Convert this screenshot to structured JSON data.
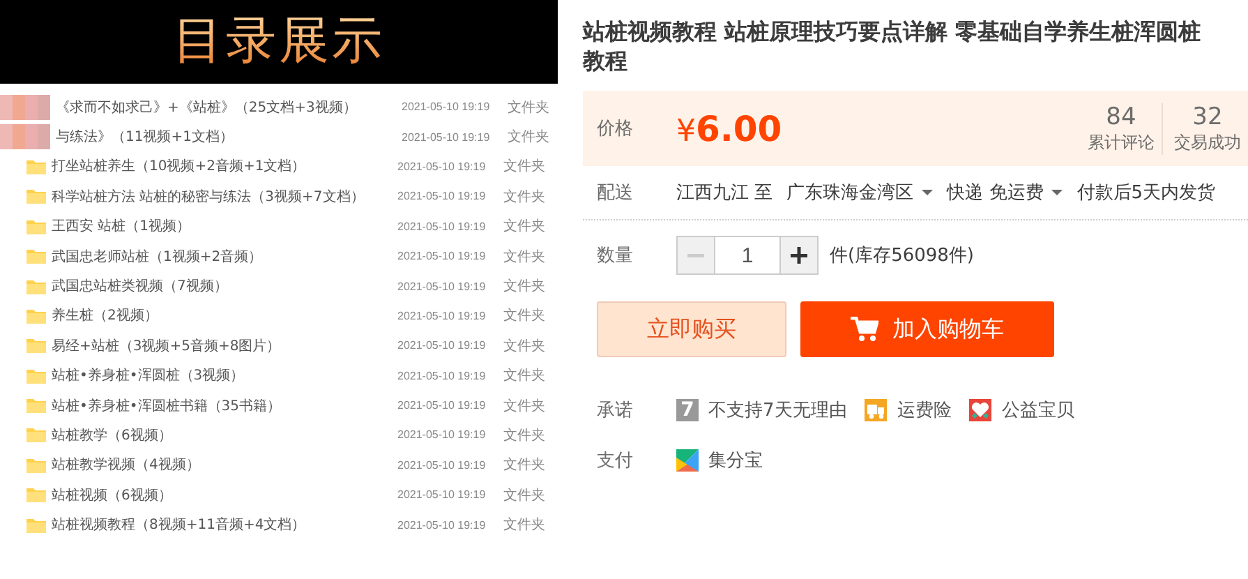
{
  "banner": {
    "title": "目录展示"
  },
  "files": [
    {
      "name": "《求而不如求己》+《站桩》（25文档+3视频）",
      "date": "2021-05-10 19:19",
      "type": "文件夹",
      "obscured": true
    },
    {
      "name": "与练法》（11视频+1文档）",
      "date": "2021-05-10 19:19",
      "type": "文件夹",
      "obscured": true
    },
    {
      "name": "打坐站桩养生（10视频+2音频+1文档）",
      "date": "2021-05-10 19:19",
      "type": "文件夹",
      "obscured": false
    },
    {
      "name": "科学站桩方法 站桩的秘密与练法（3视频+7文档）",
      "date": "2021-05-10 19:19",
      "type": "文件夹",
      "obscured": false
    },
    {
      "name": "王西安 站桩（1视频）",
      "date": "2021-05-10 19:19",
      "type": "文件夹",
      "obscured": false
    },
    {
      "name": "武国忠老师站桩（1视频+2音频）",
      "date": "2021-05-10 19:19",
      "type": "文件夹",
      "obscured": false
    },
    {
      "name": "武国忠站桩类视频（7视频）",
      "date": "2021-05-10 19:19",
      "type": "文件夹",
      "obscured": false
    },
    {
      "name": "养生桩（2视频）",
      "date": "2021-05-10 19:19",
      "type": "文件夹",
      "obscured": false
    },
    {
      "name": "易经+站桩（3视频+5音频+8图片）",
      "date": "2021-05-10 19:19",
      "type": "文件夹",
      "obscured": false
    },
    {
      "name": "站桩•养身桩•浑圆桩（3视频）",
      "date": "2021-05-10 19:19",
      "type": "文件夹",
      "obscured": false
    },
    {
      "name": "站桩•养身桩•浑圆桩书籍（35书籍）",
      "date": "2021-05-10 19:19",
      "type": "文件夹",
      "obscured": false
    },
    {
      "name": "站桩教学（6视频）",
      "date": "2021-05-10 19:19",
      "type": "文件夹",
      "obscured": false
    },
    {
      "name": "站桩教学视频（4视频）",
      "date": "2021-05-10 19:19",
      "type": "文件夹",
      "obscured": false
    },
    {
      "name": "站桩视频（6视频）",
      "date": "2021-05-10 19:19",
      "type": "文件夹",
      "obscured": false
    },
    {
      "name": "站桩视频教程（8视频+11音频+4文档）",
      "date": "2021-05-10 19:19",
      "type": "文件夹",
      "obscured": false
    }
  ],
  "product": {
    "title": "站桩视频教程 站桩原理技巧要点详解 零基础自学养生桩浑圆桩教程",
    "price": {
      "label": "价格",
      "currency": "¥",
      "amount": "6.00"
    },
    "stats": [
      {
        "value": "84",
        "label": "累计评论"
      },
      {
        "value": "32",
        "label": "交易成功"
      }
    ],
    "delivery": {
      "label": "配送",
      "from": "江西九江 至",
      "to": "广东珠海金湾区",
      "shipping": "快递 免运费",
      "dispatch": "付款后5天内发货"
    },
    "quantity": {
      "label": "数量",
      "value": "1",
      "minus_disabled": true,
      "stock": "件(库存56098件)"
    },
    "buttons": [
      {
        "label": "立即购买",
        "kind": "buy"
      },
      {
        "label": "加入购物车",
        "kind": "cart"
      }
    ],
    "promises": {
      "label": "承诺",
      "items": [
        {
          "kind": "no-return",
          "badge": "7",
          "text": "不支持7天无理由"
        },
        {
          "kind": "freight",
          "text": "运费险"
        },
        {
          "kind": "charity",
          "text": "公益宝贝"
        }
      ]
    },
    "payment": {
      "label": "支付",
      "items": [
        {
          "kind": "points",
          "text": "集分宝"
        }
      ]
    }
  }
}
